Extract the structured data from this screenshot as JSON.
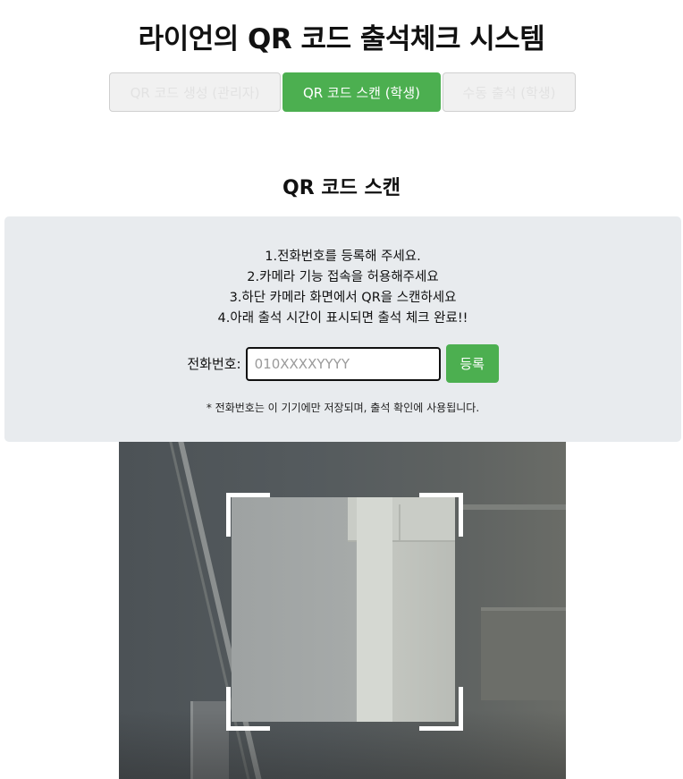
{
  "app": {
    "title": "라이언의 QR 코드 출석체크 시스템"
  },
  "tabs": [
    {
      "label": "QR 코드 생성 (관리자)",
      "active": false
    },
    {
      "label": "QR 코드 스캔 (학생)",
      "active": true
    },
    {
      "label": "수동 출석 (학생)",
      "active": false
    }
  ],
  "scan": {
    "title": "QR 코드 스캔",
    "instructions": [
      "1.전화번호를 등록해 주세요.",
      "2.카메라 기능 접속을 허용해주세요",
      "3.하단 카메라 화면에서 QR을 스캔하세요",
      "4.아래 출석 시간이 표시되면 출석 체크 완료!!"
    ],
    "phone_label": "전화번호:",
    "phone_placeholder": "010XXXXYYYY",
    "phone_value": "",
    "register_label": "등록",
    "note": "* 전화번호는 이 기기에만 저장되며, 출석 확인에 사용됩니다."
  },
  "colors": {
    "accent": "#4caf50",
    "info_box_bg": "#e8ebee"
  }
}
